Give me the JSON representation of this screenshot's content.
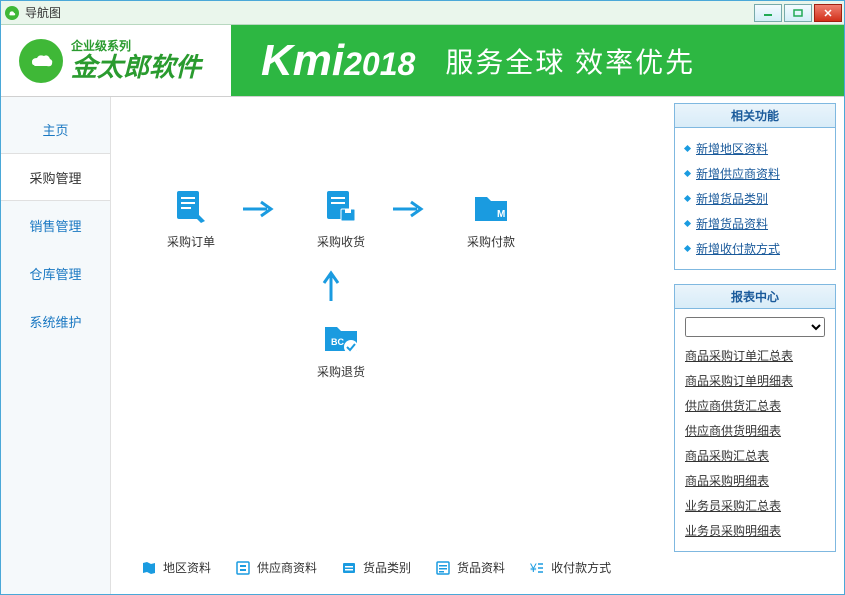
{
  "window": {
    "title": "导航图"
  },
  "banner": {
    "logo_sub": "企业级系列",
    "logo_main": "金太郎软件",
    "product": "Kmi",
    "year": "2018",
    "slogan": "服务全球 效率优先"
  },
  "sidebar": {
    "items": [
      {
        "label": "主页",
        "active": false
      },
      {
        "label": "采购管理",
        "active": true
      },
      {
        "label": "销售管理",
        "active": false
      },
      {
        "label": "仓库管理",
        "active": false
      },
      {
        "label": "系统维护",
        "active": false
      }
    ]
  },
  "workflow": {
    "nodes": [
      {
        "key": "order",
        "label": "采购订单"
      },
      {
        "key": "receive",
        "label": "采购收货"
      },
      {
        "key": "pay",
        "label": "采购付款"
      },
      {
        "key": "return",
        "label": "采购退货"
      }
    ]
  },
  "bottom_links": [
    {
      "icon": "map-icon",
      "label": "地区资料"
    },
    {
      "icon": "supplier-icon",
      "label": "供应商资料"
    },
    {
      "icon": "category-icon",
      "label": "货品类别"
    },
    {
      "icon": "goods-icon",
      "label": "货品资料"
    },
    {
      "icon": "payment-icon",
      "label": "收付款方式"
    }
  ],
  "related_panel": {
    "title": "相关功能",
    "links": [
      "新增地区资料",
      "新增供应商资料",
      "新增货品类别",
      "新增货品资料",
      "新增收付款方式"
    ]
  },
  "report_panel": {
    "title": "报表中心",
    "links": [
      "商品采购订单汇总表",
      "商品采购订单明细表",
      "供应商供货汇总表",
      "供应商供货明细表",
      "商品采购汇总表",
      "商品采购明细表",
      "业务员采购汇总表",
      "业务员采购明细表"
    ]
  }
}
